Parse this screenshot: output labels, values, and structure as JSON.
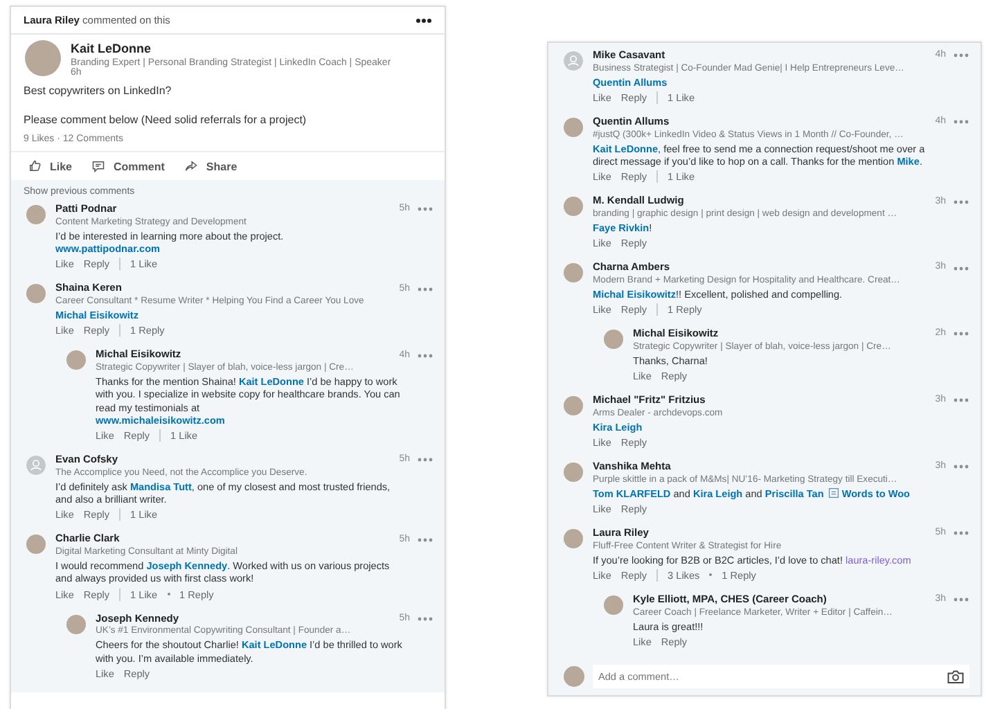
{
  "post_card": {
    "activity": "**Laura Riley** commented on this",
    "post": {
      "author": "Kait LeDonne",
      "headline": "Branding Expert | Personal Branding Strategist | LinkedIn Coach | Speaker",
      "time": "6h",
      "paragraphs": [
        "Best copywriters on LinkedIn?",
        "Please comment below (Need solid referrals for a project)"
      ],
      "stats": "9 Likes · 12 Comments"
    },
    "actions": [
      {
        "kind": "like",
        "label": "Like"
      },
      {
        "kind": "comment",
        "label": "Comment"
      },
      {
        "kind": "share",
        "label": "Share"
      }
    ],
    "show_previous": "Show previous comments",
    "comments": [
      {
        "name": "Patti Podnar",
        "headline": "Content Marketing Strategy and Development",
        "time": "5h",
        "kind": "photo",
        "body": [
          {
            "kind": "text",
            "text": "I’d be interested in learning more about the project."
          },
          {
            "kind": "url",
            "text": "www.pattipodnar.com"
          }
        ],
        "actions": [
          "Like",
          "Reply"
        ],
        "stats": [
          "1 Like"
        ]
      },
      {
        "name": "Shaina Keren",
        "headline": "Career Consultant * Resume Writer * Helping You Find a Career You Love",
        "time": "5h",
        "kind": "photo",
        "body": [
          {
            "kind": "mention",
            "text": "Michal Eisikowitz"
          }
        ],
        "actions": [
          "Like",
          "Reply"
        ],
        "stats": [
          "1 Reply"
        ],
        "replies": [
          {
            "name": "Michal Eisikowitz",
            "headline": "Strategic Copywriter | Slayer of blah, voice-less jargon | Cre…",
            "time": "4h",
            "kind": "photo",
            "body": [
              {
                "kind": "text",
                "text": "Thanks for the mention Shaina! "
              },
              {
                "kind": "mention",
                "text": "Kait LeDonne"
              },
              {
                "kind": "text",
                "text": " I’d be happy to work with you. I specialize in website copy for healthcare brands. You can read my testimonials at"
              },
              {
                "kind": "url",
                "text": "www.michaleisikowitz.com"
              }
            ],
            "actions": [
              "Like",
              "Reply"
            ],
            "stats": [
              "1 Like"
            ]
          }
        ]
      },
      {
        "name": "Evan Cofsky",
        "headline": "The Accomplice you Need, not the Accomplice you Deserve.",
        "time": "5h",
        "kind": "default",
        "body": [
          {
            "kind": "text",
            "text": "I’d definitely ask "
          },
          {
            "kind": "mention",
            "text": "Mandisa Tutt"
          },
          {
            "kind": "text",
            "text": ", one of my closest and most trusted friends, and also a brilliant writer."
          }
        ],
        "actions": [
          "Like",
          "Reply"
        ],
        "stats": [
          "1 Like"
        ]
      },
      {
        "name": "Charlie Clark",
        "headline": "Digital Marketing Consultant at Minty Digital",
        "time": "5h",
        "kind": "photo",
        "body": [
          {
            "kind": "text",
            "text": "I would recommend "
          },
          {
            "kind": "mention",
            "text": "Joseph Kennedy"
          },
          {
            "kind": "text",
            "text": ". Worked with us on various projects and always provided us with first class work!"
          }
        ],
        "actions": [
          "Like",
          "Reply"
        ],
        "stats": [
          "1 Like",
          "1 Reply"
        ],
        "replies": [
          {
            "name": "Joseph Kennedy",
            "headline": "UK’s #1 Environmental Copywriting Consultant | Founder a…",
            "time": "5h",
            "kind": "photo",
            "body": [
              {
                "kind": "text",
                "text": "Cheers for the shoutout Charlie! "
              },
              {
                "kind": "mention",
                "text": "Kait LeDonne"
              },
              {
                "kind": "text",
                "text": " I’d be thrilled to work with you. I’m available immediately."
              }
            ],
            "actions": [
              "Like",
              "Reply"
            ]
          }
        ]
      }
    ]
  },
  "comments_card": {
    "comments": [
      {
        "name": "Mike Casavant",
        "headline": "Business Strategist | Co-Founder Mad Genie| I Help Entrepreneurs Leve…",
        "time": "4h",
        "kind": "default",
        "body": [
          {
            "kind": "mention",
            "text": "Quentin Allums"
          }
        ],
        "actions": [
          "Like",
          "Reply"
        ],
        "stats": [
          "1 Like"
        ]
      },
      {
        "name": "Quentin Allums",
        "headline": "#justQ (300k+ LinkedIn Video & Status Views in 1 Month // Co-Founder, …",
        "time": "4h",
        "kind": "photo",
        "body": [
          {
            "kind": "mention",
            "text": "Kait LeDonne"
          },
          {
            "kind": "text",
            "text": ", feel free to send me a connection request/shoot me over a direct message if you’d like to hop on a call. Thanks for the mention "
          },
          {
            "kind": "mention",
            "text": "Mike"
          },
          {
            "kind": "text",
            "text": "."
          }
        ],
        "actions": [
          "Like",
          "Reply"
        ],
        "stats": [
          "1 Like"
        ]
      },
      {
        "name": "M. Kendall Ludwig",
        "headline": "branding | graphic design | print design | web design and development …",
        "time": "3h",
        "kind": "photo",
        "body": [
          {
            "kind": "mention",
            "text": "Faye Rivkin"
          },
          {
            "kind": "text",
            "text": "!"
          }
        ],
        "actions": [
          "Like",
          "Reply"
        ]
      },
      {
        "name": "Charna Ambers",
        "headline": "Modern Brand + Marketing Design for Hospitality and Healthcare. Creat…",
        "time": "3h",
        "kind": "photo",
        "body": [
          {
            "kind": "mention",
            "text": "Michal Eisikowitz"
          },
          {
            "kind": "text",
            "text": "!! Excellent, polished and compelling."
          }
        ],
        "actions": [
          "Like",
          "Reply"
        ],
        "stats": [
          "1 Reply"
        ],
        "replies": [
          {
            "name": "Michal Eisikowitz",
            "headline": "Strategic Copywriter | Slayer of blah, voice-less jargon | Cre…",
            "time": "2h",
            "kind": "photo",
            "body": [
              {
                "kind": "text",
                "text": "Thanks, Charna!"
              }
            ],
            "actions": [
              "Like",
              "Reply"
            ]
          }
        ]
      },
      {
        "name": "Michael \"Fritz\" Fritzius",
        "headline": "Arms Dealer - archdevops.com",
        "time": "3h",
        "kind": "photo",
        "body": [
          {
            "kind": "mention",
            "text": "Kira Leigh"
          }
        ],
        "actions": [
          "Like",
          "Reply"
        ]
      },
      {
        "name": "Vanshika Mehta",
        "headline": "Purple skittle in a pack of M&Ms| NU’16- Marketing Strategy till Executi…",
        "time": "3h",
        "kind": "photo",
        "body": [
          {
            "kind": "mention",
            "text": "Tom KLARFELD"
          },
          {
            "kind": "text",
            "text": " and "
          },
          {
            "kind": "mention",
            "text": "Kira Leigh"
          },
          {
            "kind": "text",
            "text": " and "
          },
          {
            "kind": "mention",
            "text": "Priscilla Tan"
          },
          {
            "kind": "company",
            "text": "Words to Woo"
          }
        ],
        "actions": [
          "Like",
          "Reply"
        ]
      },
      {
        "name": "Laura Riley",
        "headline": "Fluff-Free Content Writer & Strategist for Hire",
        "time": "5h",
        "kind": "photo",
        "body": [
          {
            "kind": "text",
            "text": "If you’re looking for B2B or B2C articles, I’d love to chat! "
          },
          {
            "kind": "visited",
            "text": "laura-riley.com"
          }
        ],
        "actions": [
          "Like",
          "Reply"
        ],
        "stats": [
          "3 Likes",
          "1 Reply"
        ],
        "replies": [
          {
            "name": "Kyle Elliott, MPA, CHES (Career Coach)",
            "headline": "Career Coach | Freelance Marketer, Writer + Editor | Caffein…",
            "time": "3h",
            "kind": "photo",
            "body": [
              {
                "kind": "text",
                "text": "Laura is great!!!"
              }
            ],
            "actions": [
              "Like",
              "Reply"
            ]
          }
        ]
      }
    ],
    "composer": {
      "placeholder": "Add a comment…"
    }
  }
}
